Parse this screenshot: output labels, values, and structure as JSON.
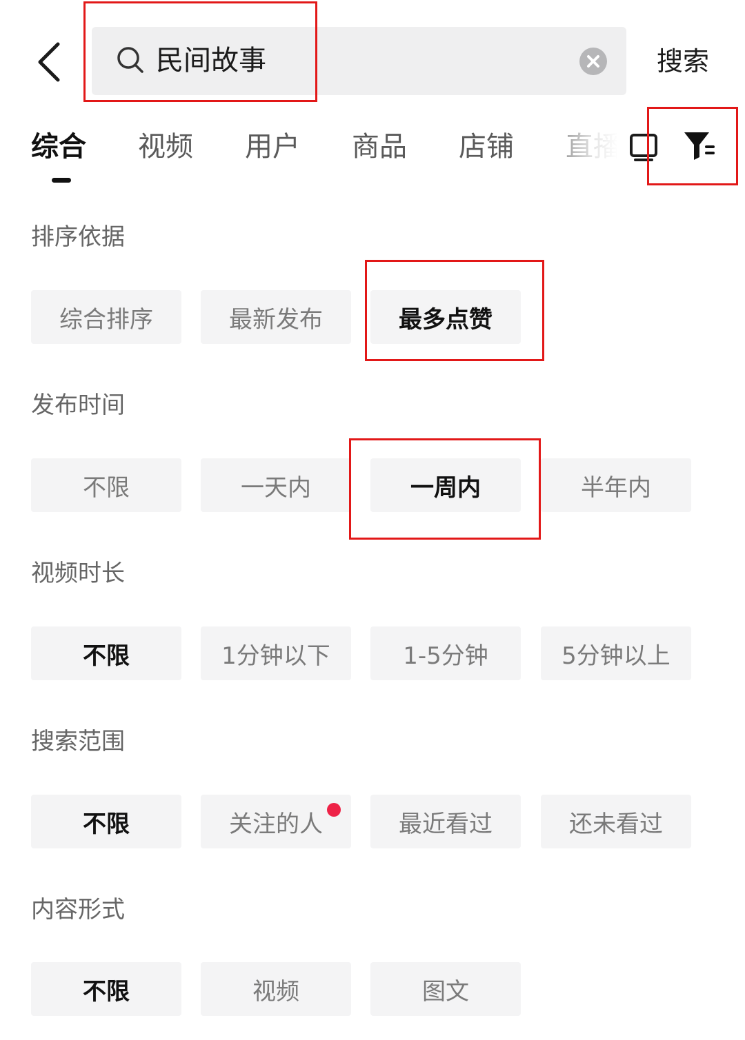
{
  "search": {
    "query": "民间故事",
    "submit_label": "搜索"
  },
  "tabs": [
    {
      "label": "综合",
      "active": true
    },
    {
      "label": "视频",
      "active": false
    },
    {
      "label": "用户",
      "active": false
    },
    {
      "label": "商品",
      "active": false
    },
    {
      "label": "店铺",
      "active": false
    },
    {
      "label": "直播",
      "active": false
    }
  ],
  "icons": {
    "back": "chevron-left-icon",
    "search": "search-icon",
    "clear": "clear-circle-icon",
    "live": "tv-icon",
    "filter": "filter-icon"
  },
  "filters": {
    "sort": {
      "title": "排序依据",
      "options": [
        "综合排序",
        "最新发布",
        "最多点赞"
      ],
      "selected": "最多点赞"
    },
    "time": {
      "title": "发布时间",
      "options": [
        "不限",
        "一天内",
        "一周内",
        "半年内"
      ],
      "selected": "一周内"
    },
    "duration": {
      "title": "视频时长",
      "options": [
        "不限",
        "1分钟以下",
        "1-5分钟",
        "5分钟以上"
      ],
      "selected": "不限"
    },
    "scope": {
      "title": "搜索范围",
      "options": [
        "不限",
        "关注的人",
        "最近看过",
        "还未看过"
      ],
      "selected": "不限"
    },
    "format": {
      "title": "内容形式",
      "options": [
        "不限",
        "视频",
        "图文"
      ],
      "selected": "不限"
    }
  },
  "colors": {
    "chip_bg": "#f4f4f5",
    "selected_text": "#111111",
    "unselected_text": "#7a7a7a",
    "notify_dot": "#ee2247",
    "annotation": "#e21818"
  }
}
